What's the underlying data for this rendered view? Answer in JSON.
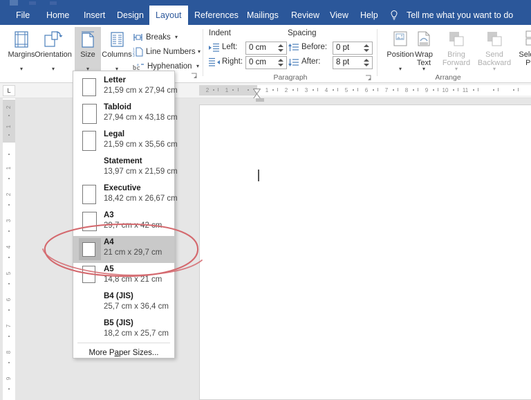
{
  "app": {
    "name": "Microsoft Word",
    "ribbon_color": "#2b579a",
    "accent_color": "#2b579a",
    "annotation_color": "#d4696e"
  },
  "tabs": [
    {
      "label": "File",
      "active": false
    },
    {
      "label": "Home",
      "active": false
    },
    {
      "label": "Insert",
      "active": false
    },
    {
      "label": "Design",
      "active": false
    },
    {
      "label": "Layout",
      "active": true
    },
    {
      "label": "References",
      "active": false
    },
    {
      "label": "Mailings",
      "active": false
    },
    {
      "label": "Review",
      "active": false
    },
    {
      "label": "View",
      "active": false
    },
    {
      "label": "Help",
      "active": false
    }
  ],
  "tellme": {
    "label": "Tell me what you want to do",
    "icon": "lightbulb-icon"
  },
  "ribbon": {
    "groups": [
      {
        "title": "",
        "name": "page-setup"
      },
      {
        "title": "Paragraph",
        "name": "paragraph"
      },
      {
        "title": "Arrange",
        "name": "arrange"
      }
    ],
    "page_setup": {
      "buttons": [
        {
          "label": "Margins",
          "label2": "",
          "icon": "margins-icon",
          "caret": "▾",
          "state": "normal"
        },
        {
          "label": "Orientation",
          "label2": "",
          "icon": "orientation-icon",
          "caret": "▾",
          "state": "normal"
        },
        {
          "label": "Size",
          "label2": "",
          "icon": "size-icon",
          "caret": "▾",
          "state": "active"
        },
        {
          "label": "Columns",
          "label2": "",
          "icon": "columns-icon",
          "caret": "▾",
          "state": "normal"
        }
      ],
      "commands": [
        {
          "label": "Breaks",
          "icon": "breaks-icon",
          "caret": "▾"
        },
        {
          "label": "Line Numbers",
          "icon": "line-numbers-icon",
          "caret": "▾"
        },
        {
          "label": "Hyphenation",
          "icon": "hyphenation-icon",
          "caret": "▾"
        }
      ]
    },
    "paragraph": {
      "title": "Paragraph",
      "indent_header": "Indent",
      "spacing_header": "Spacing",
      "fields": [
        {
          "label": "Left:",
          "value": "0 cm",
          "icon": "indent-left-icon"
        },
        {
          "label": "Right:",
          "value": "0 cm",
          "icon": "indent-right-icon"
        },
        {
          "label": "Before:",
          "value": "0 pt",
          "icon": "spacing-before-icon"
        },
        {
          "label": "After:",
          "value": "8 pt",
          "icon": "spacing-after-icon"
        }
      ]
    },
    "arrange": {
      "title": "Arrange",
      "buttons": [
        {
          "label": "Position",
          "label2": "",
          "icon": "position-icon",
          "caret": "▾",
          "state": "normal"
        },
        {
          "label": "Wrap",
          "label2": "Text",
          "icon": "wrap-text-icon",
          "caret": "▾",
          "state": "normal"
        },
        {
          "label": "Bring",
          "label2": "Forward",
          "icon": "bring-forward-icon",
          "caret": "▾",
          "state": "disabled"
        },
        {
          "label": "Send",
          "label2": "Backward",
          "icon": "send-backward-icon",
          "caret": "▾",
          "state": "disabled"
        },
        {
          "label": "Selection",
          "label2": "Pane",
          "icon": "selection-pane-icon",
          "caret": "",
          "state": "normal"
        }
      ]
    }
  },
  "size_menu": {
    "name": "paper-size-dropdown",
    "items": [
      {
        "name": "Letter",
        "dims": "21,59 cm x 27,94 cm",
        "selected": false,
        "thumb": true
      },
      {
        "name": "Tabloid",
        "dims": "27,94 cm x 43,18 cm",
        "selected": false,
        "thumb": true
      },
      {
        "name": "Legal",
        "dims": "21,59 cm x 35,56 cm",
        "selected": false,
        "thumb": true
      },
      {
        "name": "Statement",
        "dims": "13,97 cm x 21,59 cm",
        "selected": false,
        "thumb": false
      },
      {
        "name": "Executive",
        "dims": "18,42 cm x 26,67 cm",
        "selected": false,
        "thumb": true
      },
      {
        "name": "A3",
        "dims": "29,7 cm x 42 cm",
        "selected": false,
        "thumb": true
      },
      {
        "name": "A4",
        "dims": "21 cm x 29,7 cm",
        "selected": true,
        "thumb": true
      },
      {
        "name": "A5",
        "dims": "14,8 cm x 21 cm",
        "selected": false,
        "thumb": true
      },
      {
        "name": "B4 (JIS)",
        "dims": "25,7 cm x 36,4 cm",
        "selected": false,
        "thumb": false
      },
      {
        "name": "B5 (JIS)",
        "dims": "18,2 cm x 25,7 cm",
        "selected": false,
        "thumb": false
      }
    ],
    "more_prefix": "More P",
    "more_accel": "a",
    "more_suffix": "per Sizes..."
  },
  "ruler": {
    "tab_selector": "L",
    "horizontal_ticks": [
      "2",
      "1",
      "1",
      "2",
      "3",
      "4",
      "5",
      "6",
      "7",
      "8",
      "9",
      "10",
      "11"
    ],
    "vertical_ticks": [
      "2",
      "1",
      "1",
      "2",
      "3",
      "4",
      "5",
      "6",
      "7",
      "8",
      "9"
    ]
  },
  "document": {
    "cursor_visible": true
  }
}
